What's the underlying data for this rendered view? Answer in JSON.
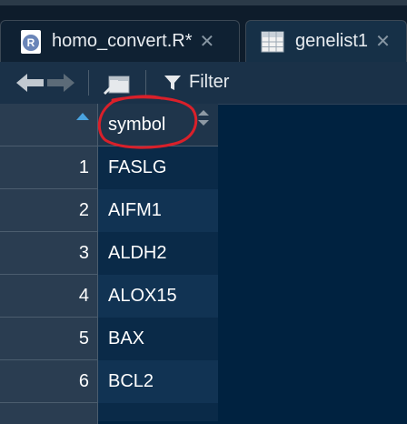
{
  "tabs": [
    {
      "label": "homo_convert.R*",
      "icon": "r-file-icon",
      "close": "✕"
    },
    {
      "label": "genelist1",
      "icon": "table-grid-icon",
      "close": "✕"
    }
  ],
  "r_badge": "R",
  "toolbar": {
    "filter_label": "Filter"
  },
  "table": {
    "column_header": "symbol",
    "rows": [
      {
        "num": "1",
        "symbol": "FASLG"
      },
      {
        "num": "2",
        "symbol": "AIFM1"
      },
      {
        "num": "3",
        "symbol": "ALDH2"
      },
      {
        "num": "4",
        "symbol": "ALOX15"
      },
      {
        "num": "5",
        "symbol": "BAX"
      },
      {
        "num": "6",
        "symbol": "BCL2"
      }
    ]
  },
  "colors": {
    "background": "#002240",
    "accent_sort": "#4aa3df",
    "annotation_circle": "#d9202a"
  }
}
